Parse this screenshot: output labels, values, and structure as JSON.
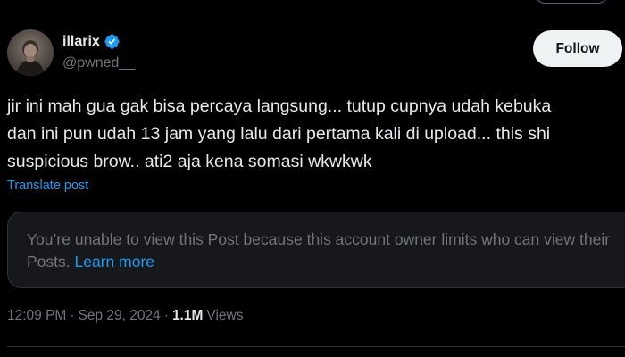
{
  "author": {
    "display_name": "illarix",
    "handle": "@pwned__",
    "verified": true
  },
  "follow_button": "Follow",
  "post": {
    "text": "jir ini mah gua gak bisa percaya langsung... tutup cupnya udah kebuka\ndan ini pun udah 13 jam yang lalu dari pertama kali di upload... this shi\nsuspicious brow.. ati2 aja kena somasi wkwkwk",
    "translate_label": "Translate post"
  },
  "quoted_notice": {
    "text": "You’re unable to view this Post because this account owner limits who can view their Posts.",
    "link": "Learn more"
  },
  "meta": {
    "time": "12:09 PM",
    "sep1": "·",
    "date": "Sep 29, 2024",
    "sep2": "·",
    "views_count": "1.1M",
    "views_label": "Views"
  },
  "icons": {
    "verified": "verified-badge-icon",
    "avatar": "avatar"
  },
  "colors": {
    "background": "#000000",
    "text_primary": "#e7e9ea",
    "text_secondary": "#71767b",
    "accent": "#1d9bf0",
    "follow_bg": "#eff3f4",
    "box_bg": "#16181c",
    "border": "#2f3336"
  }
}
